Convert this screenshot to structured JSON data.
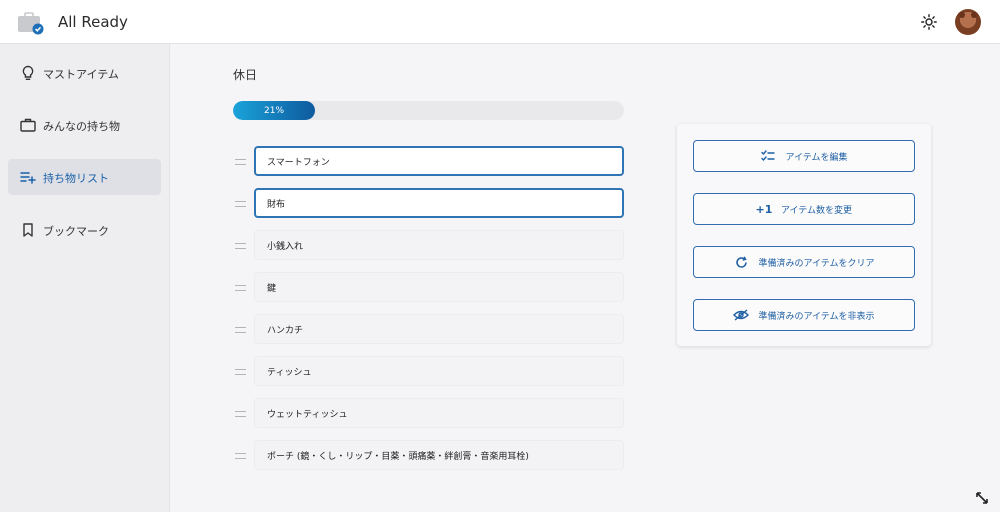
{
  "header": {
    "app_title": "All Ready"
  },
  "sidebar": {
    "items": [
      {
        "label": "マストアイテム",
        "icon": "lightbulb-icon"
      },
      {
        "label": "みんなの持ち物",
        "icon": "briefcase-icon"
      },
      {
        "label": "持ち物リスト",
        "icon": "playlist-add-icon",
        "active": true
      },
      {
        "label": "ブックマーク",
        "icon": "bookmark-icon"
      }
    ]
  },
  "main": {
    "title": "休日",
    "progress": {
      "percent": 21,
      "label": "21%"
    },
    "items": [
      {
        "label": "スマートフォン",
        "checked": true
      },
      {
        "label": "財布",
        "checked": true
      },
      {
        "label": "小銭入れ",
        "checked": false
      },
      {
        "label": "鍵",
        "checked": false
      },
      {
        "label": "ハンカチ",
        "checked": false
      },
      {
        "label": "ティッシュ",
        "checked": false
      },
      {
        "label": "ウェットティッシュ",
        "checked": false
      },
      {
        "label": "ポーチ (鏡・くし・リップ・目薬・頭痛薬・絆創膏・音楽用耳栓)",
        "checked": false
      }
    ]
  },
  "actions": {
    "edit_items": "アイテムを編集",
    "change_count_prefix": "+1",
    "change_count": "アイテム数を変更",
    "clear_ready": "準備済みのアイテムをクリア",
    "hide_ready": "準備済みのアイテムを非表示"
  },
  "colors": {
    "accent": "#2f74b5",
    "progress_start": "#1aa3d9",
    "progress_end": "#0e5a9e"
  }
}
